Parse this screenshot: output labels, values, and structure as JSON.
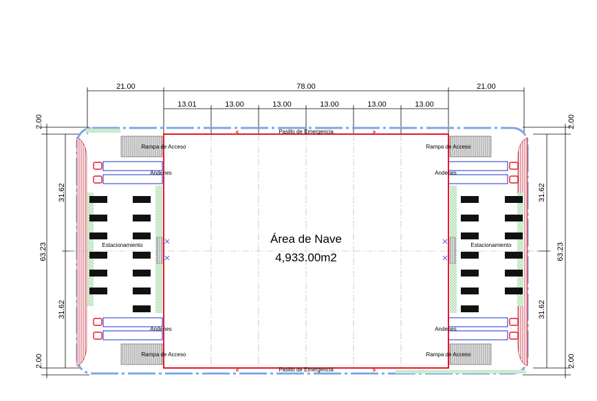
{
  "dims": {
    "top_total": "78.00",
    "top_left": "21.00",
    "top_right": "21.00",
    "bays": [
      "13.01",
      "13.00",
      "13.00",
      "13.00",
      "13.00",
      "13.00"
    ],
    "side_total": "63.23",
    "side_half": "31.62",
    "margin": "2.00"
  },
  "labels": {
    "area_title": "Área de Nave",
    "area_value": "4,933.00m2",
    "emergency": "Pasillo de Emergencia",
    "ramp": "Rampa de Acceso",
    "docks": "Andenes",
    "parking": "Estacionamiento"
  },
  "colors": {
    "building_outline": "#e8142a",
    "perimeter": "#7aa7e8",
    "dock_outline": "#1b2bd1",
    "landscape": "#2fae3c",
    "ramp_fill": "#bfbfbf",
    "dimension": "#000000"
  }
}
